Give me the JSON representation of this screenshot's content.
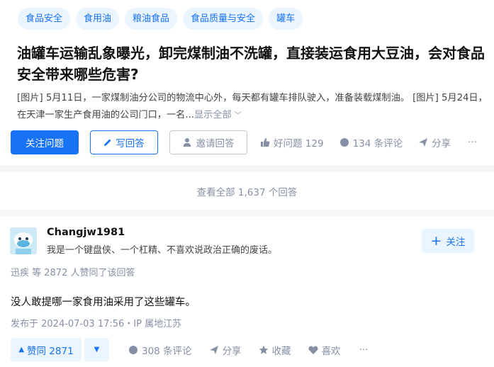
{
  "question": {
    "tags": [
      "食品安全",
      "食用油",
      "粮油食品",
      "食品质量与安全",
      "罐车"
    ],
    "title": "油罐车运输乱象曝光，卸完煤制油不洗罐，直接装运食用大豆油，会对食品安全带来哪些危害?",
    "excerpt": "[图片] 5月11日，一家煤制油分公司的物流中心外，每天都有罐车排队驶入，准备装载煤制油。 [图片] 5月24日，在天津一家生产食用油的公司门口，一名...",
    "show_all": "显示全部",
    "actions": {
      "follow": "关注问题",
      "write": "写回答",
      "invite": "邀请回答",
      "good_question": "好问题 129",
      "comments": "134 条评论",
      "share": "分享",
      "more": "···"
    }
  },
  "view_all": "查看全部 1,637 个回答",
  "answer": {
    "author_name": "Changjw1981",
    "author_bio": "我是一个键盘侠、一个杠精、不喜欢说政治正确的废话。",
    "follow": "关注",
    "upvoters": "迅疾 等 2872 人赞同了该回答",
    "content": "没人敢提哪一家食用油采用了这些罐车。",
    "published": "发布于 2024-07-03 17:56・IP 属地江苏",
    "actions": {
      "upvote": "赞同 2871",
      "comments": "308 条评论",
      "share": "分享",
      "collect": "收藏",
      "like": "喜欢",
      "more": "···"
    }
  },
  "colors": {
    "accent": "#1772f6",
    "muted": "#8590a6",
    "tag_bg": "#ebf5ff"
  }
}
